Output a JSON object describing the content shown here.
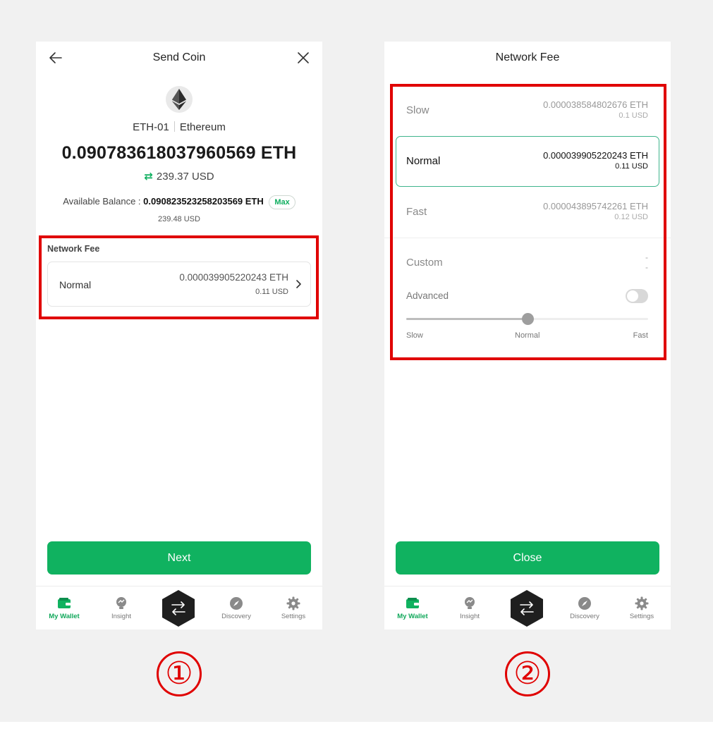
{
  "screen1": {
    "title": "Send Coin",
    "wallet_name": "ETH-01",
    "coin_name": "Ethereum",
    "amount": "0.090783618037960569 ETH",
    "amount_usd": "239.37 USD",
    "available_label": "Available Balance :",
    "available_value": "0.090823523258203569 ETH",
    "max_label": "Max",
    "available_usd": "239.48 USD",
    "network_fee_label": "Network Fee",
    "fee": {
      "speed": "Normal",
      "eth": "0.000039905220243 ETH",
      "usd": "0.11 USD"
    },
    "next_label": "Next"
  },
  "screen2": {
    "title": "Network Fee",
    "options": [
      {
        "speed": "Slow",
        "eth": "0.000038584802676 ETH",
        "usd": "0.1 USD",
        "selected": false
      },
      {
        "speed": "Normal",
        "eth": "0.000039905220243 ETH",
        "usd": "0.11 USD",
        "selected": true
      },
      {
        "speed": "Fast",
        "eth": "0.000043895742261 ETH",
        "usd": "0.12 USD",
        "selected": false
      }
    ],
    "custom": {
      "label": "Custom",
      "eth": "-",
      "usd": "-"
    },
    "advanced_label": "Advanced",
    "advanced_on": false,
    "slider": {
      "labels": [
        "Slow",
        "Normal",
        "Fast"
      ],
      "value": 0.5
    },
    "close_label": "Close"
  },
  "nav": {
    "items": [
      {
        "label": "My Wallet",
        "icon": "wallet-icon",
        "active": true
      },
      {
        "label": "Insight",
        "icon": "insight-icon",
        "active": false
      },
      {
        "label": "Discovery",
        "icon": "compass-icon",
        "active": false
      },
      {
        "label": "Settings",
        "icon": "gear-icon",
        "active": false
      }
    ],
    "center_icon": "swap-icon"
  },
  "markers": [
    "①",
    "②"
  ],
  "colors": {
    "primary": "#10b260",
    "annotation": "#e00000",
    "selected_border": "#3fb58c"
  }
}
